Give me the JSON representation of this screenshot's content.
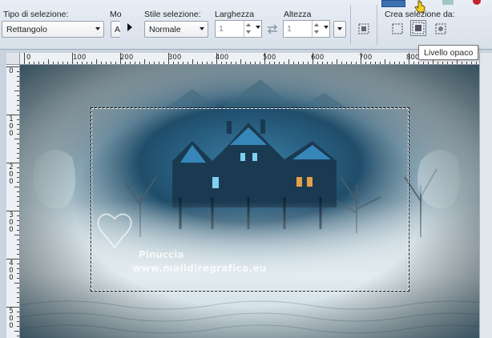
{
  "toolbar": {
    "selection_type": {
      "label": "Tipo di selezione:",
      "value": "Rettangolo"
    },
    "mode": {
      "label": "Mo",
      "value": "A"
    },
    "selection_style": {
      "label": "Stile selezione:",
      "value": "Normale"
    },
    "width": {
      "label": "Larghezza",
      "value": "1"
    },
    "height": {
      "label": "Altezza",
      "value": "1"
    },
    "create_selection_from": {
      "label": "Crea selezione da:"
    }
  },
  "tooltip": {
    "text": "Livello opaco"
  },
  "ruler_h": [
    "0",
    "100",
    "200",
    "300",
    "400",
    "500",
    "600",
    "700",
    "800"
  ],
  "ruler_v": [
    "0",
    "100",
    "200",
    "300",
    "400",
    "500"
  ],
  "watermark": {
    "name": "Pinuccia",
    "url": "www.maildiregrafica.eu"
  },
  "icons": [
    "chevron-right-icon",
    "link-dimensions-icon",
    "selection-from-layer-icon",
    "selection-from-opaque-layer-icon",
    "selection-from-mask-icon",
    "pointer-hand-icon"
  ],
  "colors": {
    "toolbar_bg": "#dde4ec",
    "canvas_dark": "#2f5566",
    "canvas_light": "#cfdbe0",
    "tooltip_border": "#767676"
  }
}
